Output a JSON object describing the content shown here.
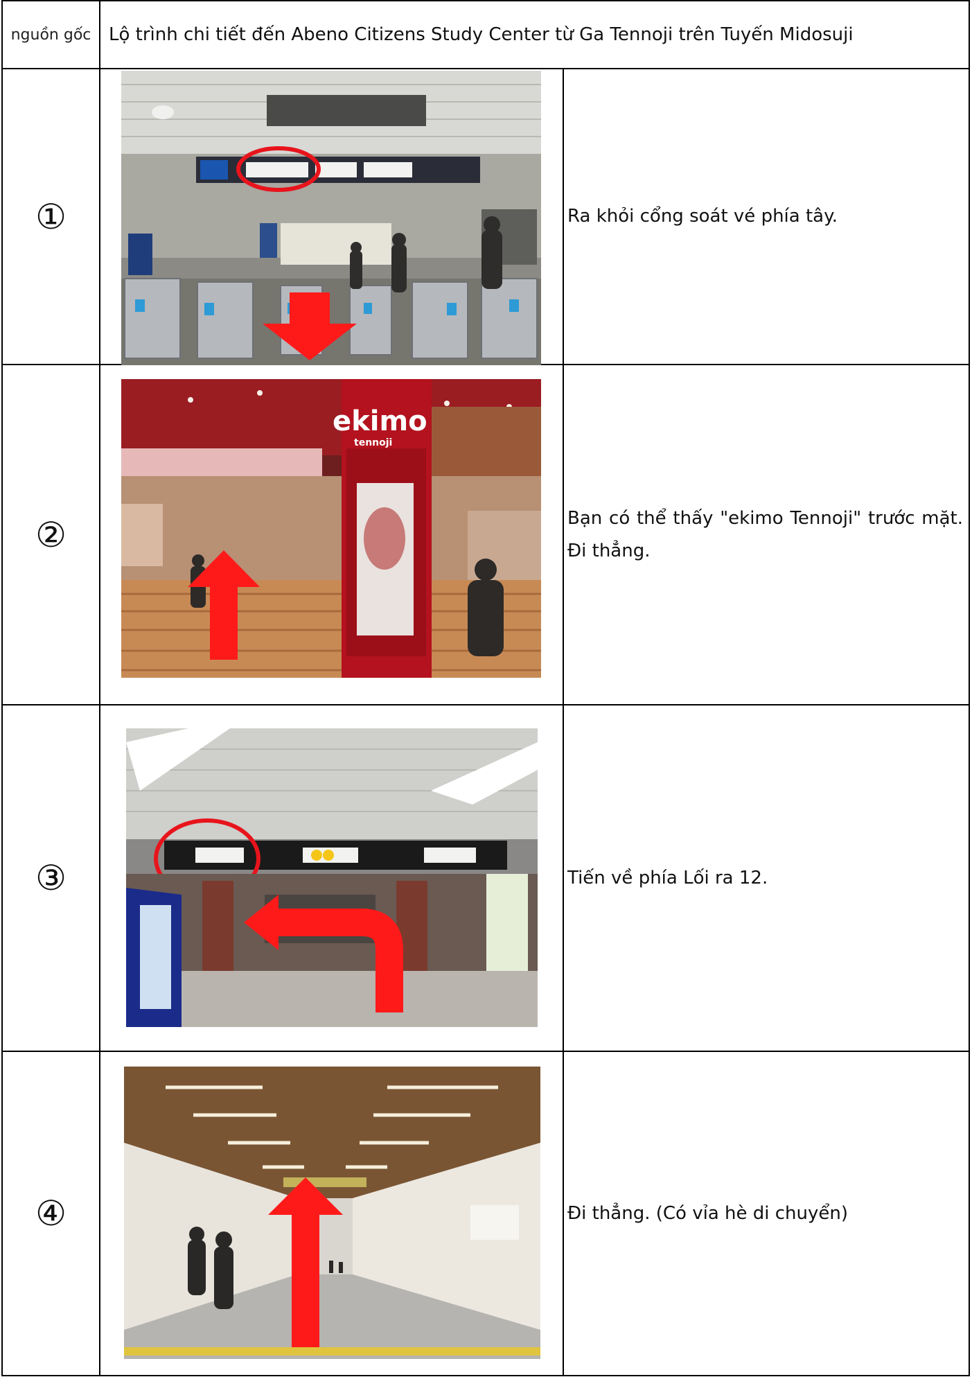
{
  "header": {
    "origin_label": "nguồn gốc",
    "route_title": "Lộ trình chi tiết đến Abeno Citizens Study Center từ Ga Tennoji trên Tuyến Midosuji"
  },
  "steps": [
    {
      "number": "①",
      "description": "Ra khỏi cổng soát vé phía tây.",
      "photo_icon": "ticket-gate-photo"
    },
    {
      "number": "②",
      "description": "Bạn có thể thấy \"ekimo Tennoji\" trước mặt. Đi thẳng.",
      "photo_icon": "ekimo-tennoji-photo",
      "sign_text": "ekimo",
      "sign_subtext": "tennoji"
    },
    {
      "number": "③",
      "description": "Tiến về phía Lối ra 12.",
      "photo_icon": "exit-sign-photo"
    },
    {
      "number": "④",
      "description": "Đi thẳng. (Có vỉa hè di chuyển)",
      "photo_icon": "corridor-photo"
    }
  ],
  "colors": {
    "arrow_red": "#ff1a1a",
    "circle_red": "#e8141c",
    "ekimo_red": "#b3121e"
  }
}
